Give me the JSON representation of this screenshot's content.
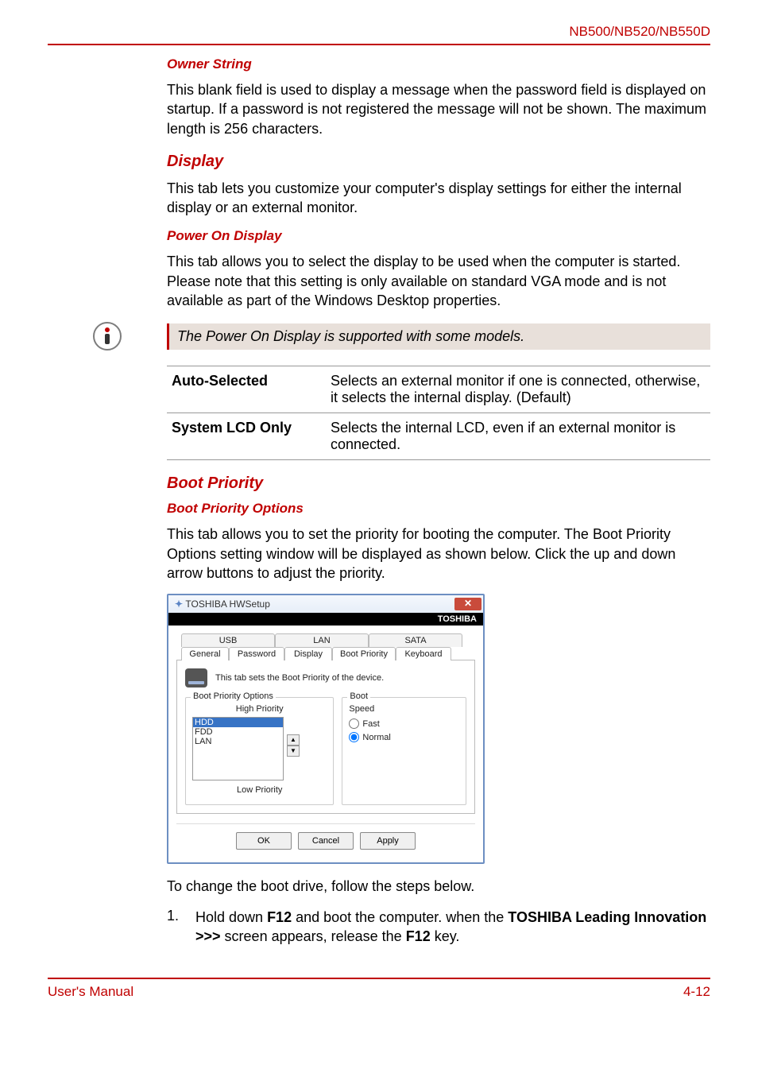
{
  "header": {
    "model": "NB500/NB520/NB550D"
  },
  "sections": {
    "owner_string": {
      "title": "Owner String",
      "body": "This blank field is used to display a message when the password field is displayed on startup. If a password is not registered the message will not be shown. The maximum length is 256 characters."
    },
    "display": {
      "title": "Display",
      "body": "This tab lets you customize your computer's display settings for either the internal display or an external monitor."
    },
    "power_on_display": {
      "title": "Power On Display",
      "body": "This tab allows you to select the display to be used when the computer is started. Please note that this setting is only available on standard VGA mode and is not available as part of the Windows Desktop properties.",
      "note": "The Power On Display is supported with some models.",
      "options": [
        {
          "name": "Auto-Selected",
          "desc": "Selects an external monitor if one is connected, otherwise, it selects the internal display. (Default)"
        },
        {
          "name": "System LCD Only",
          "desc": "Selects the internal LCD, even if an external monitor is connected."
        }
      ]
    },
    "boot_priority": {
      "title": "Boot Priority",
      "subtitle": "Boot Priority Options",
      "body": "This tab allows you to set the priority for booting the computer. The Boot Priority Options setting window will be displayed as shown below. Click the up and down arrow buttons to adjust the priority.",
      "change_intro": "To change the boot drive, follow the steps below.",
      "step1_pre": "Hold down ",
      "step1_key1": "F12",
      "step1_mid": " and boot the computer. when the ",
      "step1_brand": "TOSHIBA Leading Innovation >>>",
      "step1_post": " screen appears, release the ",
      "step1_key2": "F12",
      "step1_end": " key."
    }
  },
  "screenshot": {
    "window_title": "TOSHIBA HWSetup",
    "brand": "TOSHIBA",
    "tabs_back": [
      "USB",
      "LAN",
      "SATA"
    ],
    "tabs_front": [
      "General",
      "Password",
      "Display",
      "Boot Priority",
      "Keyboard"
    ],
    "active_tab": "Boot Priority",
    "tab_desc": "This tab sets the Boot Priority of the device.",
    "group_boot_priority": "Boot Priority Options",
    "label_high": "High Priority",
    "label_low": "Low Priority",
    "priority_list": [
      "HDD",
      "FDD",
      "LAN"
    ],
    "selected_item": "HDD",
    "group_boot": "Boot",
    "label_speed": "Speed",
    "radio_fast": "Fast",
    "radio_normal": "Normal",
    "selected_speed": "Normal",
    "buttons": {
      "ok": "OK",
      "cancel": "Cancel",
      "apply": "Apply"
    }
  },
  "footer": {
    "left": "User's Manual",
    "right": "4-12"
  }
}
